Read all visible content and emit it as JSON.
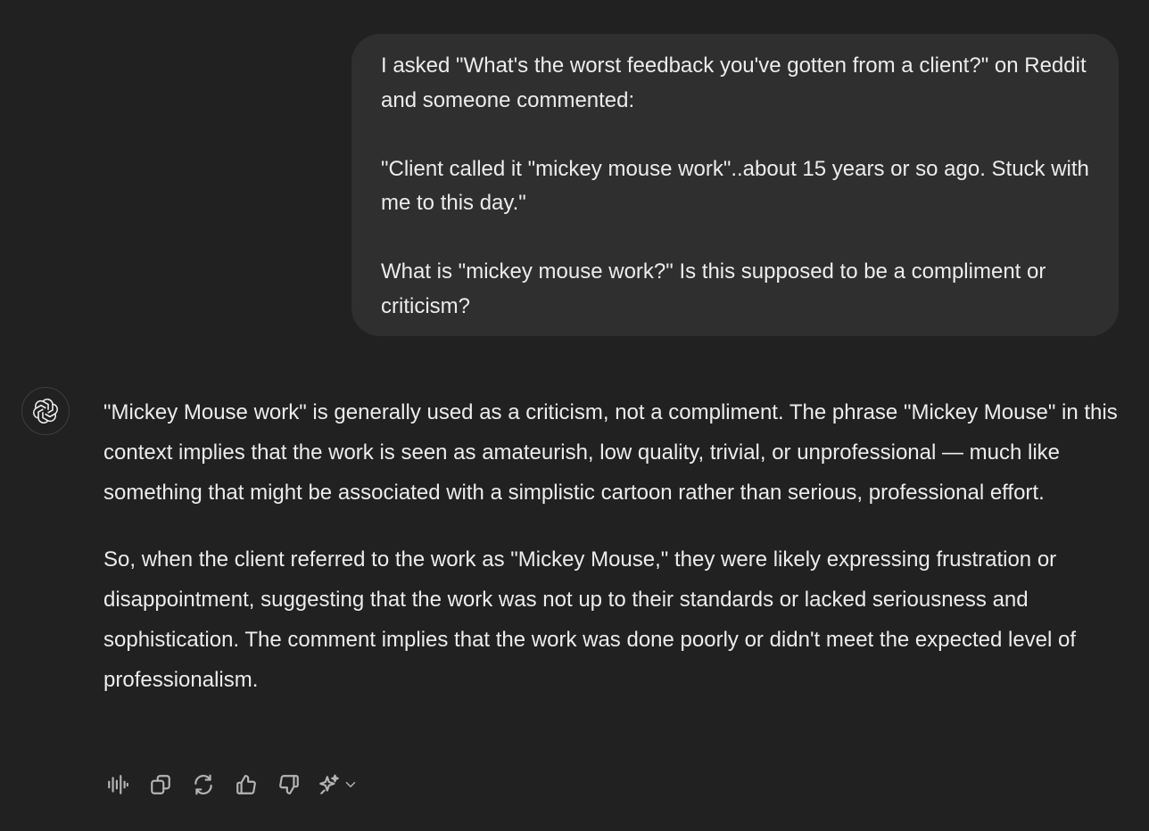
{
  "user_message": {
    "paragraphs": [
      "I asked \"What's the worst feedback you've gotten from a client?\" on Reddit and someone commented:",
      "\"Client called it \"mickey mouse work\"..about 15 years or so ago. Stuck with me to this day.\"",
      "What is \"mickey mouse work?\" Is this supposed to be a compliment or criticism?"
    ]
  },
  "assistant_message": {
    "avatar_icon": "openai-logo-icon",
    "paragraphs": [
      "\"Mickey Mouse work\" is generally used as a criticism, not a compliment. The phrase \"Mickey Mouse\" in this context implies that the work is seen as amateurish, low quality, trivial, or unprofessional — much like something that might be associated with a simplistic cartoon rather than serious, professional effort.",
      "So, when the client referred to the work as \"Mickey Mouse,\" they were likely expressing frustration or disappointment, suggesting that the work was not up to their standards or lacked seriousness and sophistication. The comment implies that the work was done poorly or didn't meet the expected level of professionalism."
    ]
  },
  "actions": {
    "icons": [
      "read-aloud-icon",
      "copy-icon",
      "regenerate-icon",
      "thumbs-up-icon",
      "thumbs-down-icon",
      "sparkle-icon",
      "chevron-down-icon"
    ]
  },
  "colors": {
    "background": "#212121",
    "bubble": "#2f2f2f",
    "text": "#ececec",
    "icon": "#b4b4b4"
  }
}
